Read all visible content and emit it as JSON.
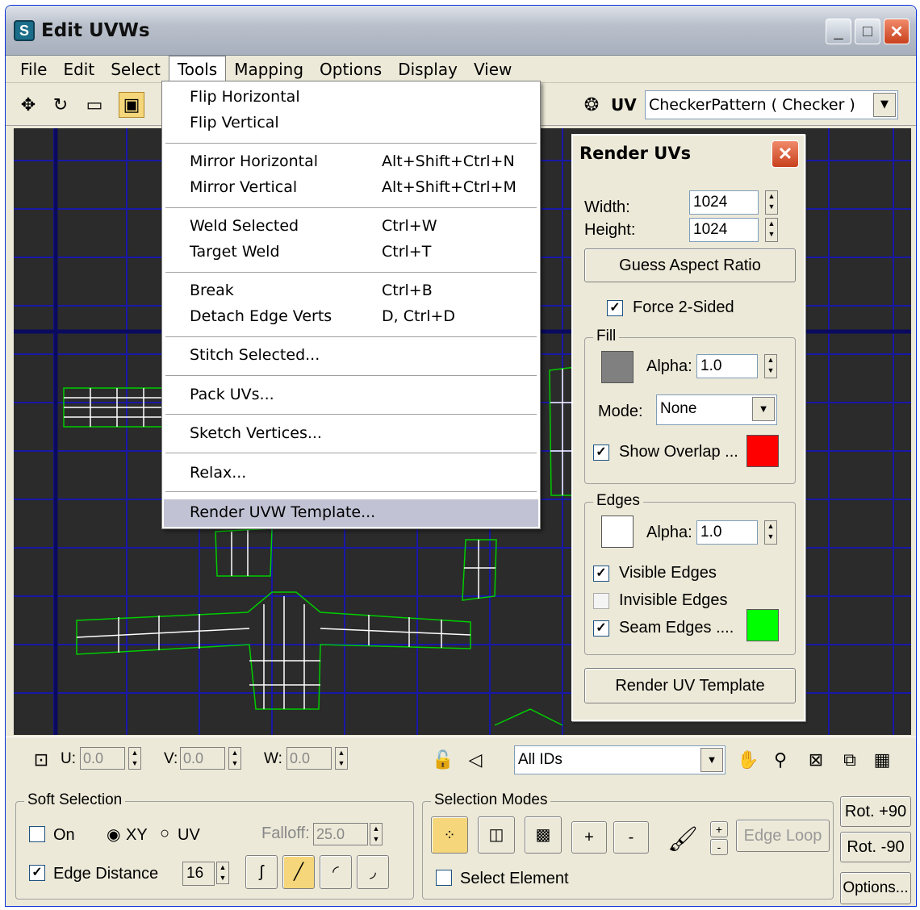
{
  "window": {
    "title": "Edit UVWs",
    "app_icon": "3ds-max-icon"
  },
  "menubar": {
    "items": [
      "File",
      "Edit",
      "Select",
      "Tools",
      "Mapping",
      "Options",
      "Display",
      "View"
    ]
  },
  "toolbar": {
    "uv_label": "UV",
    "texture_select": "CheckerPattern  ( Checker )"
  },
  "tools_menu": {
    "groups": [
      [
        {
          "label": "Flip Horizontal",
          "shortcut": ""
        },
        {
          "label": "Flip Vertical",
          "shortcut": ""
        }
      ],
      [
        {
          "label": "Mirror Horizontal",
          "shortcut": "Alt+Shift+Ctrl+N"
        },
        {
          "label": "Mirror Vertical",
          "shortcut": "Alt+Shift+Ctrl+M"
        }
      ],
      [
        {
          "label": "Weld Selected",
          "shortcut": "Ctrl+W"
        },
        {
          "label": "Target Weld",
          "shortcut": "Ctrl+T"
        }
      ],
      [
        {
          "label": "Break",
          "shortcut": "Ctrl+B"
        },
        {
          "label": "Detach Edge Verts",
          "shortcut": "D, Ctrl+D"
        }
      ],
      [
        {
          "label": "Stitch Selected...",
          "shortcut": ""
        }
      ],
      [
        {
          "label": "Pack UVs...",
          "shortcut": ""
        }
      ],
      [
        {
          "label": "Sketch Vertices...",
          "shortcut": ""
        }
      ],
      [
        {
          "label": "Relax...",
          "shortcut": ""
        }
      ],
      [
        {
          "label": "Render UVW Template...",
          "shortcut": ""
        }
      ]
    ],
    "highlighted": "Render UVW Template..."
  },
  "render_panel": {
    "title": "Render UVs",
    "width_label": "Width:",
    "width_value": "1024",
    "height_label": "Height:",
    "height_value": "1024",
    "guess_button": "Guess Aspect Ratio",
    "force_label": "Force 2-Sided",
    "force_checked": true,
    "fill": {
      "title": "Fill",
      "color": "#808080",
      "alpha_label": "Alpha:",
      "alpha": "1.0",
      "mode_label": "Mode:",
      "mode": "None",
      "overlap_label": "Show Overlap ...",
      "overlap_checked": true,
      "overlap_color": "#ff0000"
    },
    "edges": {
      "title": "Edges",
      "color": "#ffffff",
      "alpha_label": "Alpha:",
      "alpha": "1.0",
      "visible_label": "Visible Edges",
      "visible_checked": true,
      "invisible_label": "Invisible Edges",
      "invisible_checked": false,
      "seam_label": "Seam Edges ....",
      "seam_checked": true,
      "seam_color": "#00ff00"
    },
    "render_button": "Render UV Template"
  },
  "bottombar": {
    "u_label": "U:",
    "u_value": "0.0",
    "v_label": "V:",
    "v_value": "0.0",
    "w_label": "W:",
    "w_value": "0.0",
    "ids_select": "All IDs"
  },
  "soft_selection": {
    "title": "Soft Selection",
    "on_label": "On",
    "on_checked": false,
    "xy_label": "XY",
    "uv_label": "UV",
    "xy_selected": true,
    "falloff_label": "Falloff:",
    "falloff_value": "25.0",
    "edge_distance_label": "Edge Distance",
    "edge_distance_checked": true,
    "edge_distance_value": "16"
  },
  "selection_modes": {
    "title": "Selection Modes",
    "plus_label": "+",
    "minus_label": "-",
    "edge_loop_label": "Edge Loop",
    "select_element_label": "Select Element",
    "select_element_checked": false
  },
  "right_buttons": {
    "rot_plus": "Rot. +90",
    "rot_minus": "Rot. -90",
    "options": "Options..."
  },
  "colors": {
    "accent_select": "#f5d67a",
    "grid_line": "#1818a8",
    "mesh_edge": "#ffffff",
    "seam_edge": "#00cc00",
    "viewport_bg": "#2b2b2b"
  }
}
